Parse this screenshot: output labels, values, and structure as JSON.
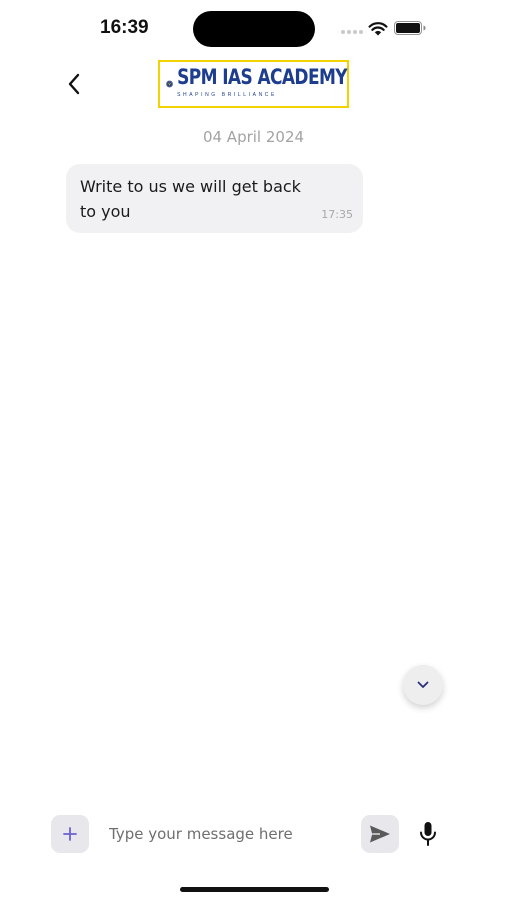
{
  "status_bar": {
    "time": "16:39"
  },
  "header": {
    "logo": {
      "title": "SPM IAS ACADEMY",
      "tagline": "SHAPING BRILLIANCE"
    }
  },
  "chat": {
    "date_separator": "04 April 2024",
    "messages": [
      {
        "text": "Write to us we will get back to you",
        "time": "17:35"
      }
    ]
  },
  "composer": {
    "placeholder": "Type your message here",
    "value": ""
  },
  "icons": {
    "back": "chevron-left-icon",
    "scroll_down": "chevron-down-icon",
    "attach": "plus-icon",
    "send": "send-icon",
    "mic": "microphone-icon"
  },
  "colors": {
    "brand_blue": "#1d3d8f",
    "brand_yellow": "#f2d200",
    "bubble_bg": "#f1f1f3",
    "accent_purple": "#6b5fd3"
  }
}
